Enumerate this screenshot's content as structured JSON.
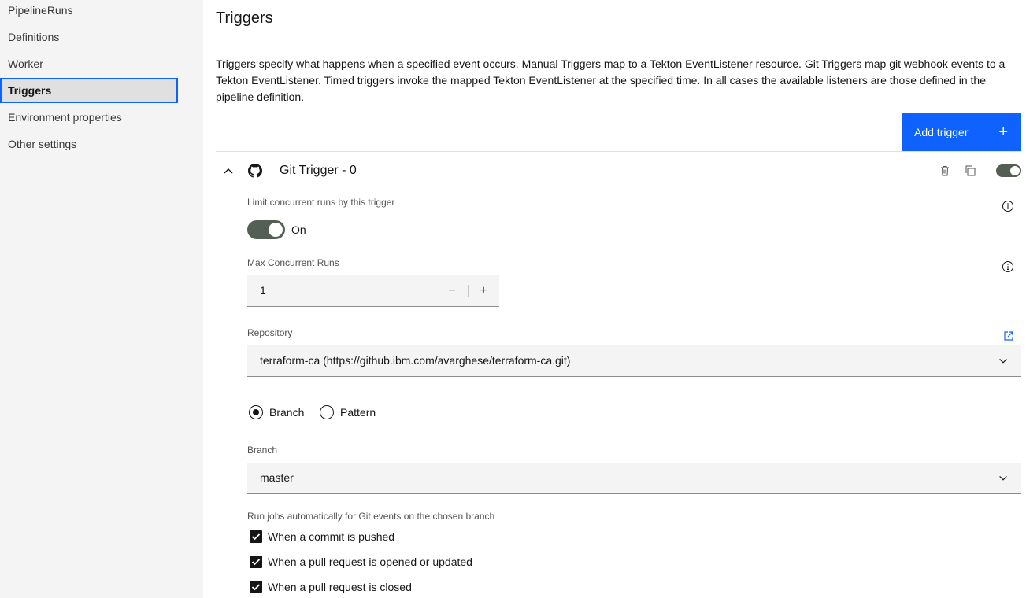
{
  "sidebar": {
    "items": [
      {
        "label": "PipelineRuns"
      },
      {
        "label": "Definitions"
      },
      {
        "label": "Worker"
      },
      {
        "label": "Triggers",
        "active": true
      },
      {
        "label": "Environment properties"
      },
      {
        "label": "Other settings"
      }
    ]
  },
  "page": {
    "title": "Triggers",
    "description": "Triggers specify what happens when a specified event occurs. Manual Triggers map to a Tekton EventListener resource. Git Triggers map git webhook events to a Tekton EventListener. Timed triggers invoke the mapped Tekton EventListener at the specified time. In all cases the available listeners are those defined in the pipeline definition.",
    "add_trigger_label": "Add trigger"
  },
  "trigger": {
    "name": "Git Trigger - 0",
    "enabled": true,
    "limit_label": "Limit concurrent runs by this trigger",
    "limit_state": "On",
    "max_runs_label": "Max Concurrent Runs",
    "max_runs_value": "1",
    "repository_label": "Repository",
    "repository_value": "terraform-ca (https://github.ibm.com/avarghese/terraform-ca.git)",
    "radio_branch": "Branch",
    "radio_pattern": "Pattern",
    "selected_radio": "Branch",
    "branch_label": "Branch",
    "branch_value": "master",
    "events_label": "Run jobs automatically for Git events on the chosen branch",
    "events": [
      {
        "label": "When a commit is pushed",
        "checked": true
      },
      {
        "label": "When a pull request is opened or updated",
        "checked": true
      },
      {
        "label": "When a pull request is closed",
        "checked": true
      }
    ]
  },
  "colors": {
    "accent": "#0f62fe",
    "toggle_on": "#525f52",
    "sidebar_bg": "#f4f4f4"
  }
}
